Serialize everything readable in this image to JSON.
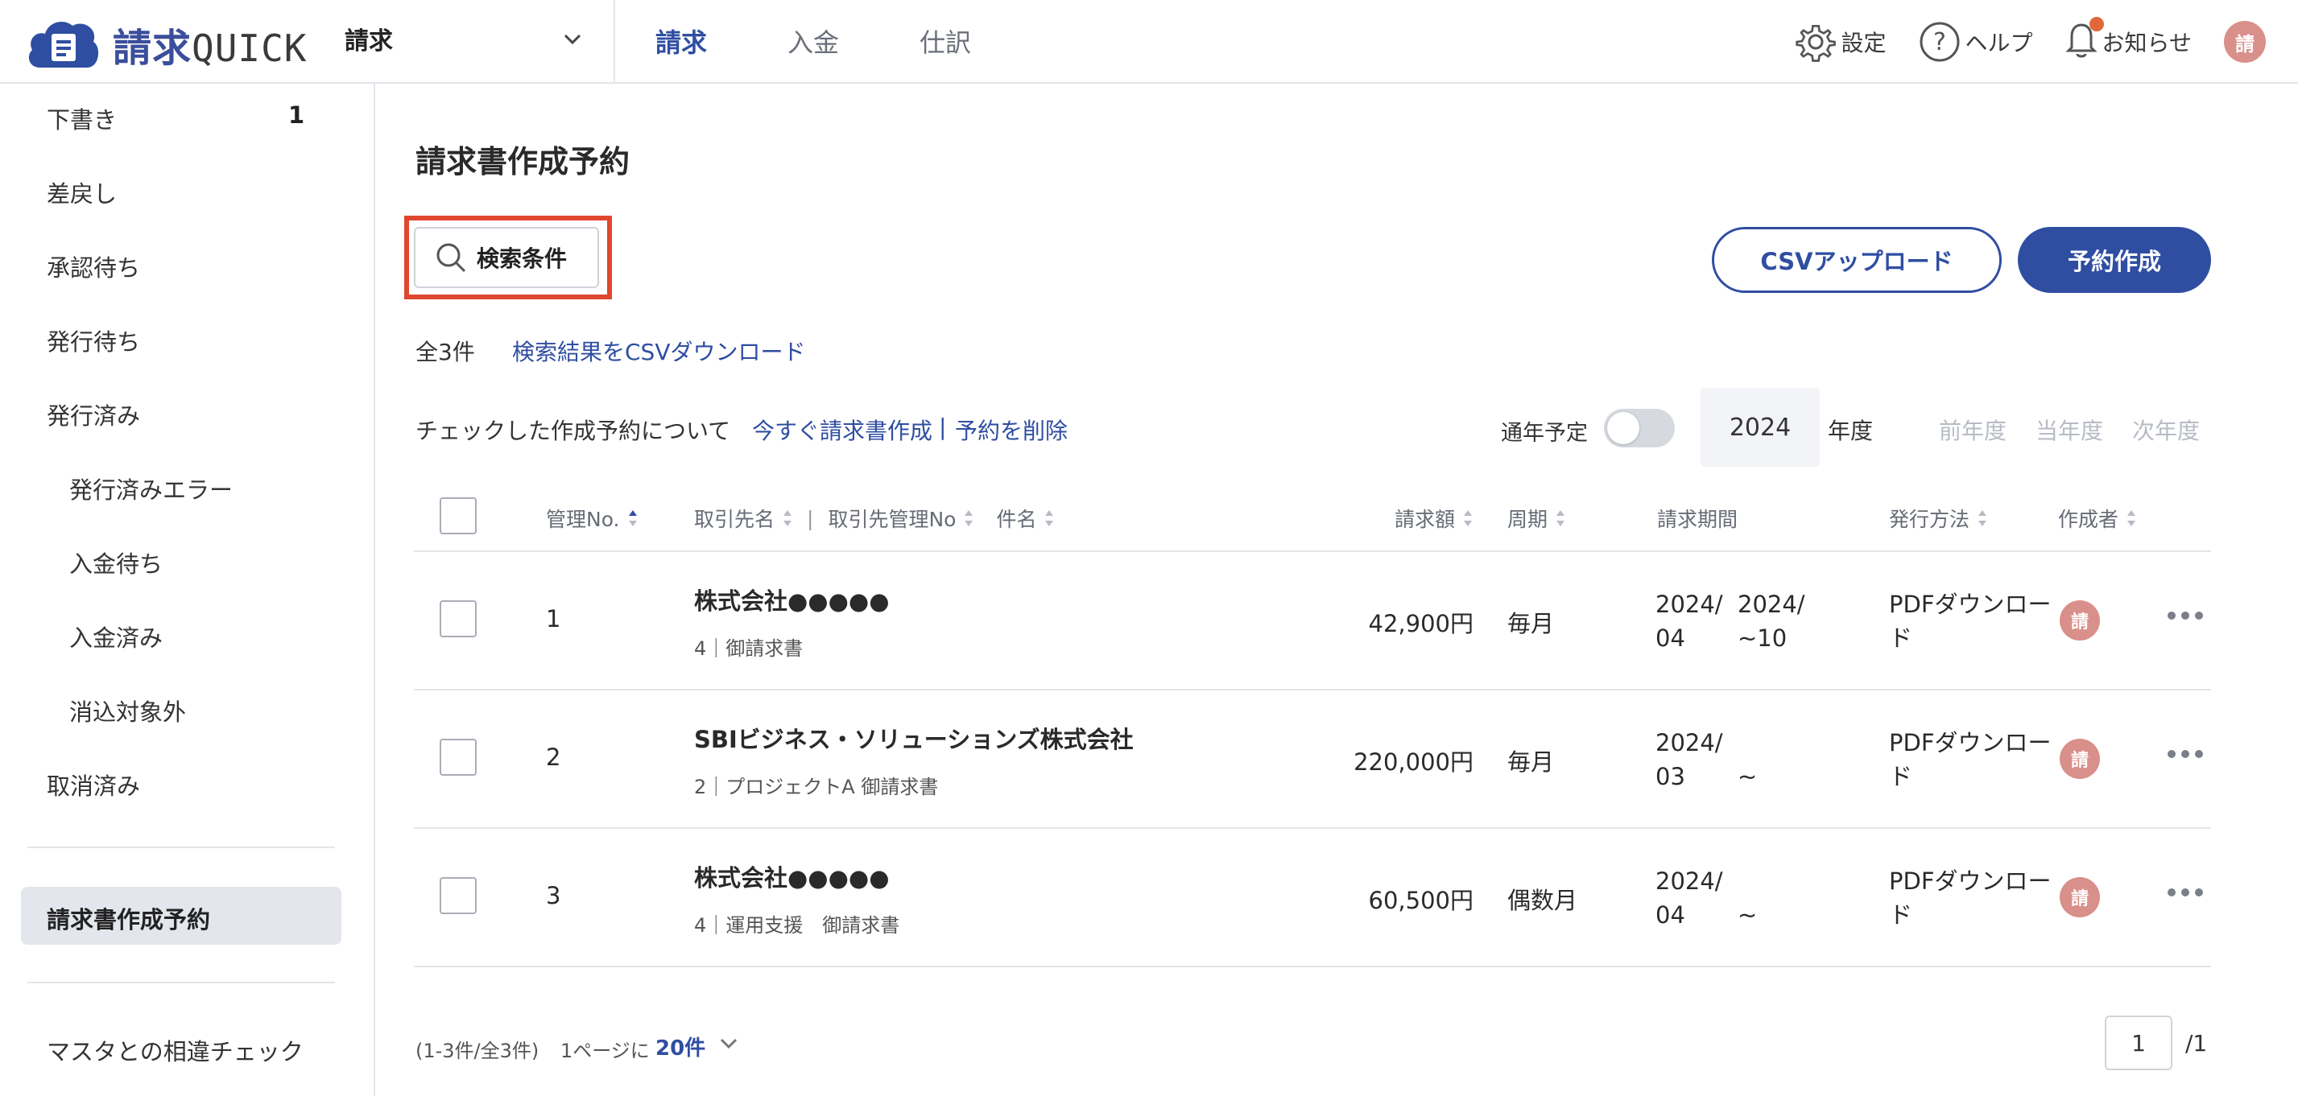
{
  "header": {
    "logo_main": "請求",
    "logo_sub": "QUICK",
    "product": "請求",
    "nav": [
      {
        "label": "請求",
        "active": true
      },
      {
        "label": "入金",
        "active": false
      },
      {
        "label": "仕訳",
        "active": false
      }
    ],
    "settings": "設定",
    "help": "ヘルプ",
    "notifications": "お知らせ",
    "avatar": "請"
  },
  "sidebar": {
    "items": [
      {
        "label": "下書き",
        "count": "1"
      },
      {
        "label": "差戻し"
      },
      {
        "label": "承認待ち"
      },
      {
        "label": "発行待ち"
      },
      {
        "label": "発行済み"
      },
      {
        "label": "発行済みエラー"
      },
      {
        "label": "入金待ち"
      },
      {
        "label": "入金済み"
      },
      {
        "label": "消込対象外"
      },
      {
        "label": "取消済み"
      }
    ],
    "active": "請求書作成予約",
    "bottom": "マスタとの相違チェック"
  },
  "main": {
    "title": "請求書作成予約",
    "search_label": "検索条件",
    "csv_upload": "CSVアップロード",
    "create": "予約作成",
    "total": "全3件",
    "csv_download": "検索結果をCSVダウンロード",
    "checked_label": "チェックした作成予約について",
    "action_now": "今すぐ請求書作成",
    "action_sep": "|",
    "action_delete": "予約を削除",
    "annual_label": "通年予定",
    "year": "2024",
    "year_suffix": "年度",
    "prev_year": "前年度",
    "this_year": "当年度",
    "next_year": "次年度"
  },
  "table": {
    "headers": {
      "no": "管理No.",
      "client": "取引先名",
      "sep": "|",
      "client_no": "取引先管理No",
      "subject": "件名",
      "amount": "請求額",
      "cycle": "周期",
      "period": "請求期間",
      "method": "発行方法",
      "creator": "作成者"
    },
    "rows": [
      {
        "no": "1",
        "client": "株式会社●●●●●",
        "sub": "4｜御請求書",
        "amount": "42,900円",
        "cycle": "毎月",
        "period_start": "2024/\n04",
        "period_end": "2024/\n~10",
        "method": "PDFダウンロー\nド",
        "creator": "請"
      },
      {
        "no": "2",
        "client": "SBIビジネス・ソリューションズ株式会社",
        "sub": "2｜プロジェクトA 御請求書",
        "amount": "220,000円",
        "cycle": "毎月",
        "period_start": "2024/\n03",
        "period_end": "\n~",
        "method": "PDFダウンロー\nド",
        "creator": "請"
      },
      {
        "no": "3",
        "client": "株式会社●●●●●",
        "sub": "4｜運用支援　御請求書",
        "amount": "60,500円",
        "cycle": "偶数月",
        "period_start": "2024/\n04",
        "period_end": "\n~",
        "method": "PDFダウンロー\nド",
        "creator": "請"
      }
    ]
  },
  "footer": {
    "range": "(1-3件/全3件)",
    "per_page_label": "1ページに",
    "per_page": "20件",
    "page": "1",
    "page_total": "/1"
  },
  "colors": {
    "accent": "#2f4ea2",
    "highlight": "#e0472f",
    "avatar": "#d98f8a"
  }
}
